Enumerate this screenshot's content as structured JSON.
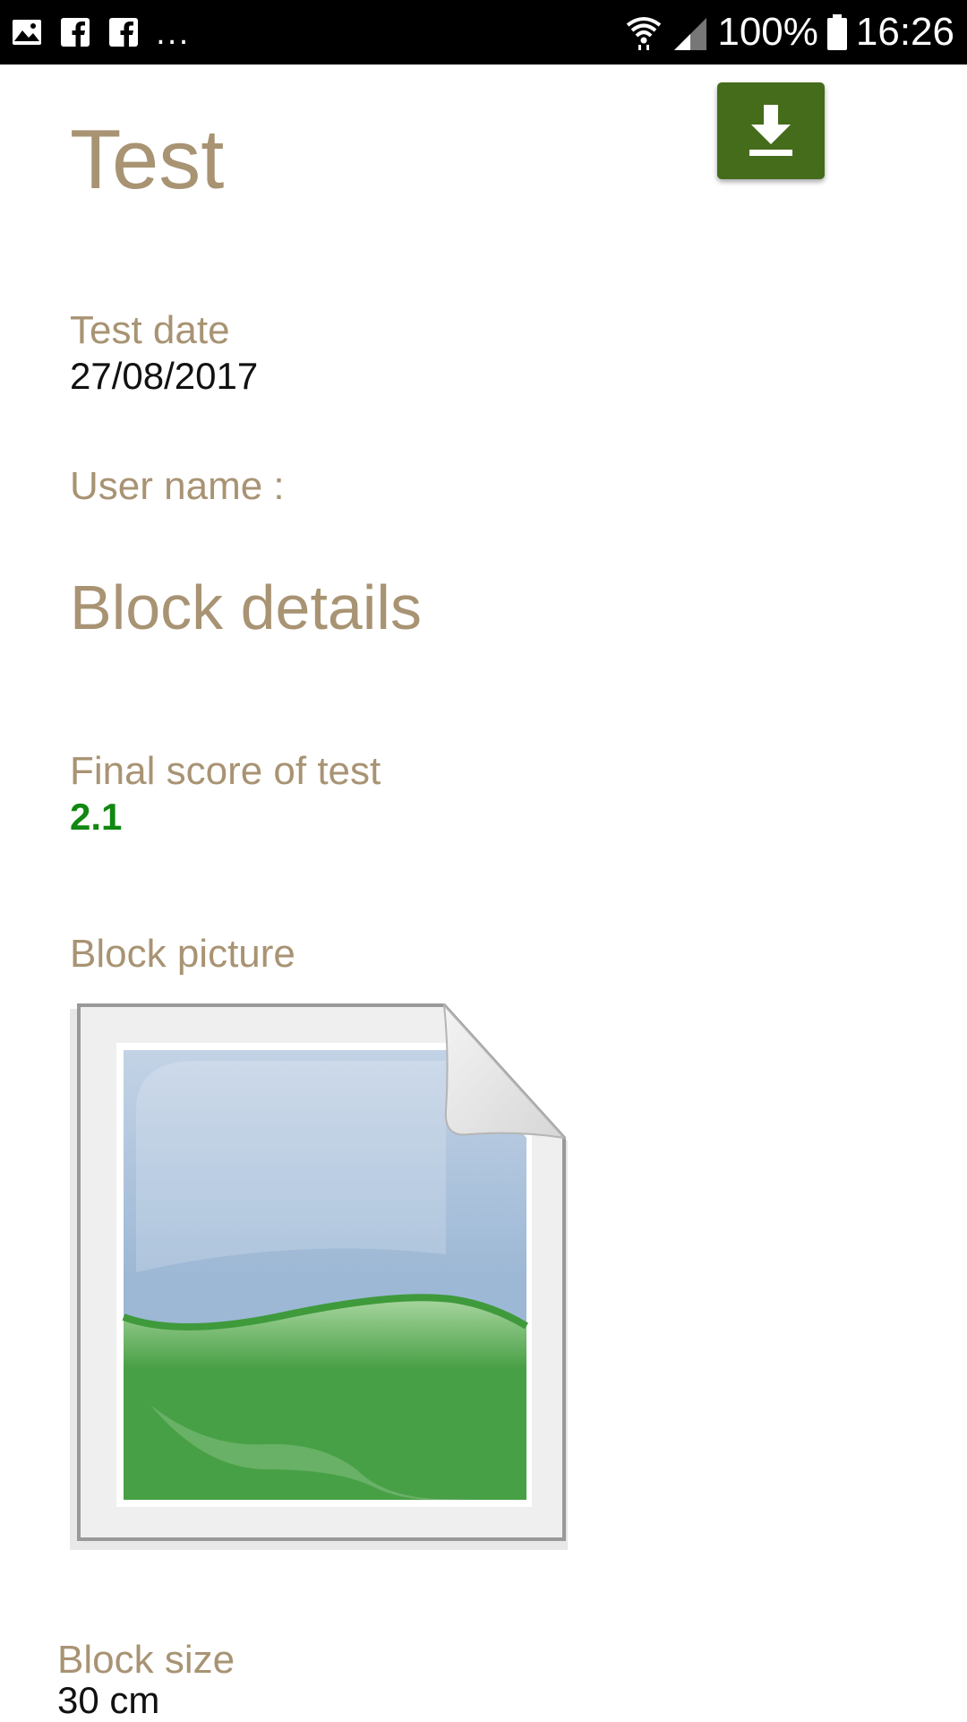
{
  "status_bar": {
    "left_icons": [
      "image-notification-icon",
      "facebook-icon",
      "facebook-icon"
    ],
    "more": "...",
    "battery": "100%",
    "time": "16:26"
  },
  "page": {
    "title": "Test",
    "download_icon": "download-icon"
  },
  "test_date": {
    "label": "Test date",
    "value": "27/08/2017"
  },
  "user_name": {
    "label": "User name :",
    "value": ""
  },
  "block_details": {
    "title": "Block details"
  },
  "final_score": {
    "label": "Final score of test",
    "value": "2.1"
  },
  "block_picture": {
    "label": "Block picture",
    "icon": "image-placeholder-icon"
  },
  "block_size": {
    "label": "Block size",
    "value": "30 cm"
  },
  "colors": {
    "label": "#a89373",
    "accent_button": "#446c1b",
    "score": "#118811",
    "status_bar": "#000000"
  }
}
